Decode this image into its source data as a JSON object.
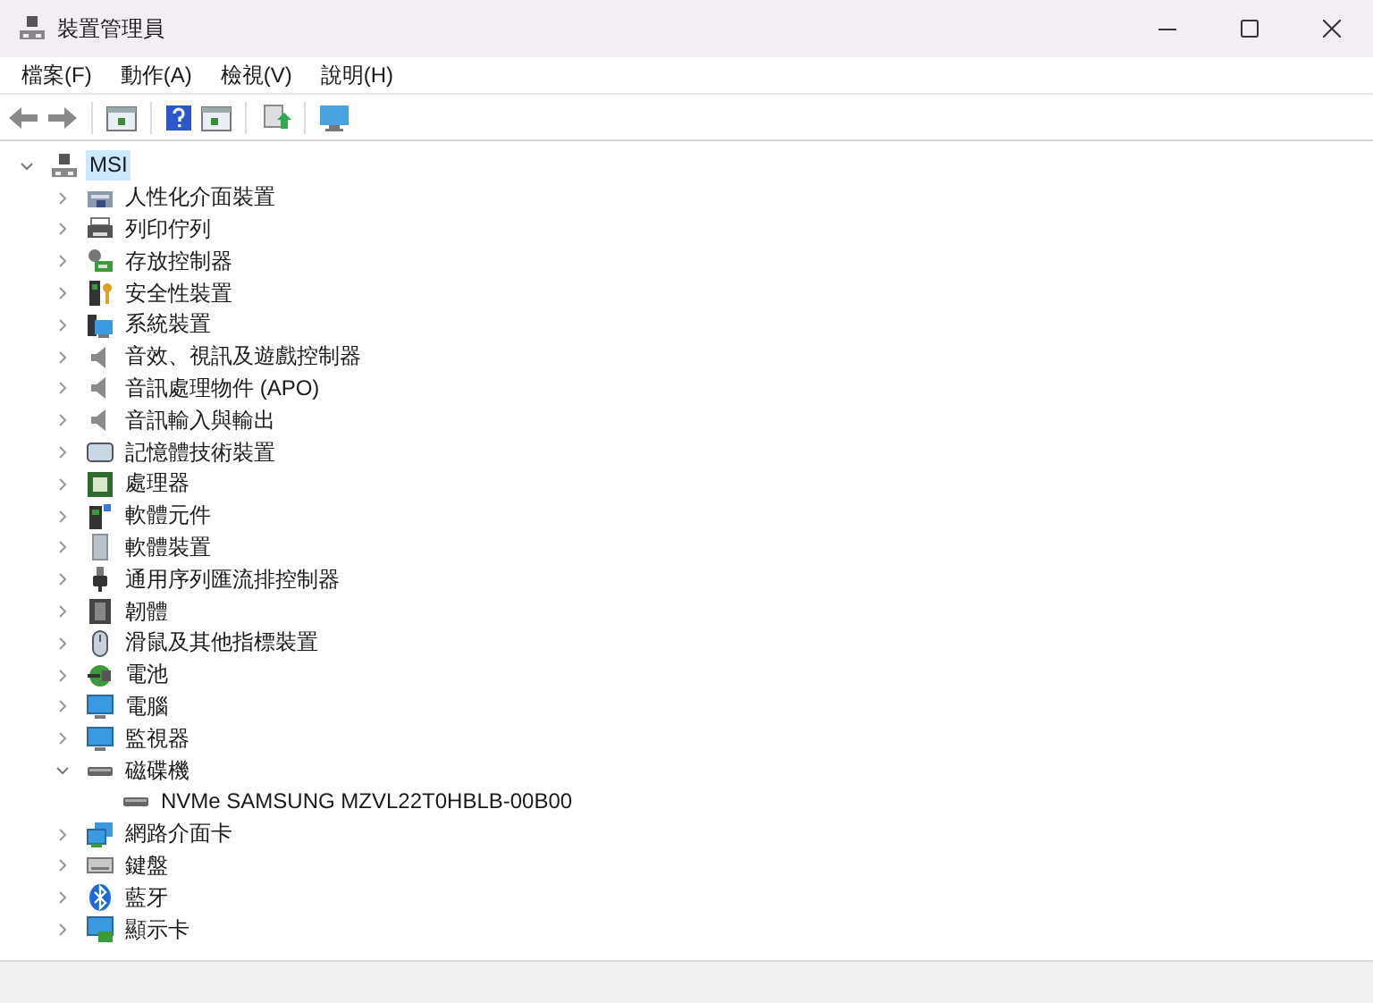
{
  "window": {
    "title": "裝置管理員"
  },
  "menu": [
    "檔案(F)",
    "動作(A)",
    "檢視(V)",
    "說明(H)"
  ],
  "tree": {
    "label": "MSI",
    "expanded": true,
    "selected": true,
    "children": [
      {
        "label": "人性化介面裝置",
        "expanded": false,
        "selected": false
      },
      {
        "label": "列印佇列",
        "expanded": false,
        "selected": false
      },
      {
        "label": "存放控制器",
        "expanded": false,
        "selected": false
      },
      {
        "label": "安全性裝置",
        "expanded": false,
        "selected": false
      },
      {
        "label": "系統裝置",
        "expanded": false,
        "selected": false
      },
      {
        "label": "音效、視訊及遊戲控制器",
        "expanded": false,
        "selected": false
      },
      {
        "label": "音訊處理物件 (APO)",
        "expanded": false,
        "selected": false
      },
      {
        "label": "音訊輸入與輸出",
        "expanded": false,
        "selected": false
      },
      {
        "label": "記憶體技術裝置",
        "expanded": false,
        "selected": false
      },
      {
        "label": "處理器",
        "expanded": false,
        "selected": false
      },
      {
        "label": "軟體元件",
        "expanded": false,
        "selected": false
      },
      {
        "label": "軟體裝置",
        "expanded": false,
        "selected": false
      },
      {
        "label": "通用序列匯流排控制器",
        "expanded": false,
        "selected": false
      },
      {
        "label": "韌體",
        "expanded": false,
        "selected": false
      },
      {
        "label": "滑鼠及其他指標裝置",
        "expanded": false,
        "selected": false
      },
      {
        "label": "電池",
        "expanded": false,
        "selected": false
      },
      {
        "label": "電腦",
        "expanded": false,
        "selected": false
      },
      {
        "label": "監視器",
        "expanded": false,
        "selected": false
      },
      {
        "label": "磁碟機",
        "expanded": true,
        "selected": false,
        "children": [
          {
            "label": "NVMe SAMSUNG MZVL22T0HBLB-00B00",
            "selected": false
          }
        ]
      },
      {
        "label": "網路介面卡",
        "expanded": false,
        "selected": false
      },
      {
        "label": "鍵盤",
        "expanded": false,
        "selected": false
      },
      {
        "label": "藍牙",
        "expanded": false,
        "selected": false
      },
      {
        "label": "顯示卡",
        "expanded": false,
        "selected": false
      }
    ]
  }
}
